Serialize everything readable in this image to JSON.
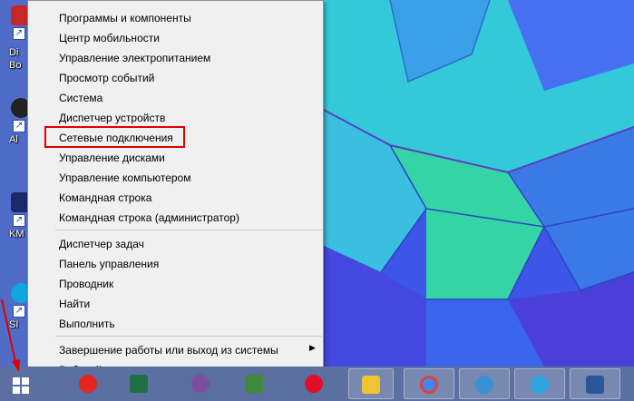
{
  "menu": {
    "groups": [
      [
        "Программы и компоненты",
        "Центр мобильности",
        "Управление электропитанием",
        "Просмотр событий",
        "Система",
        "Диспетчер устройств",
        "Сетевые подключения",
        "Управление дисками",
        "Управление компьютером",
        "Командная строка",
        "Командная строка (администратор)"
      ],
      [
        "Диспетчер задач",
        "Панель управления",
        "Проводник",
        "Найти",
        "Выполнить"
      ],
      [
        "Завершение работы или выход из системы",
        "Рабочий стол"
      ]
    ],
    "submenu_arrow": "▶",
    "highlighted_item": "Сетевые подключения",
    "highlight_color": "#e00000"
  },
  "desktop": {
    "icons": [
      {
        "label": "Di",
        "label2": "Bo",
        "icon": "app-icon-red"
      },
      {
        "label": "Al",
        "icon": "app-icon-shield"
      },
      {
        "label": "KM",
        "icon": "app-icon-km"
      },
      {
        "label": "SI",
        "icon": "app-icon-skype"
      }
    ],
    "shortcut_arrow": "↗"
  },
  "taskbar": {
    "buttons": [
      {
        "name": "start-button",
        "icon": "windows-logo-icon"
      },
      {
        "name": "taskbar-yandex",
        "icon": "yandex-icon",
        "color": "#e52620"
      },
      {
        "name": "taskbar-excel",
        "icon": "excel-icon",
        "color": "#1e7145"
      },
      {
        "name": "taskbar-viber",
        "icon": "viber-icon",
        "color": "#7b519d"
      },
      {
        "name": "taskbar-access",
        "icon": "green-app-icon",
        "color": "#3d8b3d"
      },
      {
        "name": "taskbar-opera",
        "icon": "opera-icon",
        "color": "#e0102b"
      },
      {
        "name": "taskbar-explorer",
        "icon": "folder-icon",
        "color": "#f1c232"
      },
      {
        "name": "taskbar-chrome",
        "icon": "chrome-icon",
        "color": "#4285f4"
      },
      {
        "name": "taskbar-maxthon",
        "icon": "bird-icon",
        "color": "#3b8fd4"
      },
      {
        "name": "taskbar-telegram",
        "icon": "telegram-icon",
        "color": "#2ca5e0"
      },
      {
        "name": "taskbar-word",
        "icon": "word-icon",
        "color": "#2b579a"
      }
    ]
  }
}
